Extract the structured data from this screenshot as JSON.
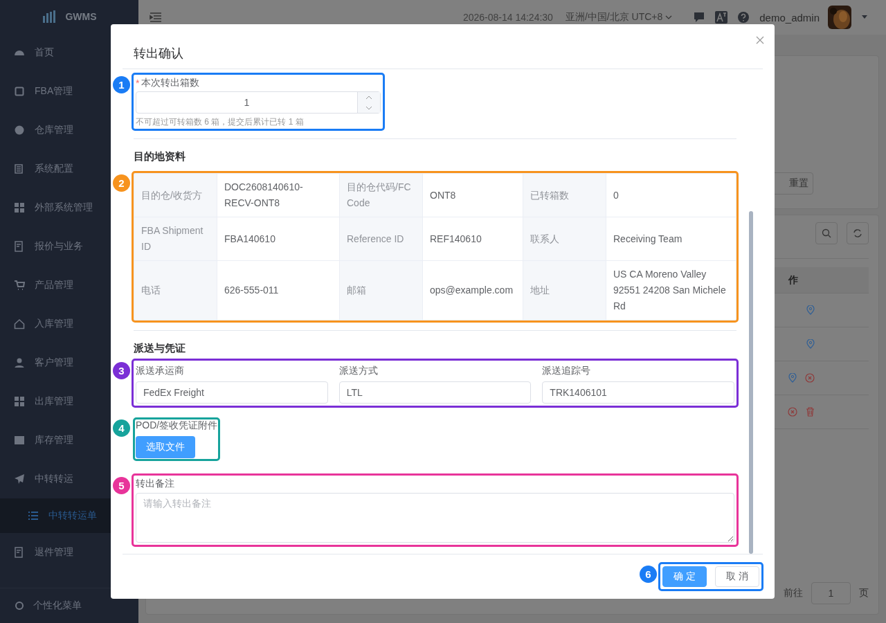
{
  "sidebar": {
    "logo": "GWMS",
    "items": [
      {
        "label": "首页",
        "selected": false
      },
      {
        "label": "FBA管理",
        "selected": false
      },
      {
        "label": "仓库管理",
        "selected": false
      },
      {
        "label": "系统配置",
        "selected": false
      },
      {
        "label": "外部系统管理",
        "selected": false
      },
      {
        "label": "报价与业务",
        "selected": false
      },
      {
        "label": "产品管理",
        "selected": false
      },
      {
        "label": "入库管理",
        "selected": false
      },
      {
        "label": "客户管理",
        "selected": false
      },
      {
        "label": "出库管理",
        "selected": false
      },
      {
        "label": "库存管理",
        "selected": false
      },
      {
        "label": "中转转运",
        "selected": false,
        "expanded": true,
        "children": [
          {
            "label": "中转转运单",
            "selected": true
          }
        ]
      },
      {
        "label": "退件管理",
        "selected": false
      }
    ],
    "footer": "个性化菜单"
  },
  "topbar": {
    "datetime": "2026-08-14 14:24:30",
    "timezone": "亚洲/中国/北京 UTC+8",
    "user": "demo_admin"
  },
  "background": {
    "reset_button": "重置",
    "column_header": "作",
    "pager": {
      "goto_label": "前往",
      "page": "1",
      "page_unit": "页"
    }
  },
  "dialog": {
    "title": "转出确认",
    "quantity": {
      "label": "本次转出箱数",
      "required_mark": "*",
      "value": "1",
      "hint": "不可超过可转箱数 6 箱，提交后累计已转 1 箱",
      "callout": {
        "number": "1",
        "color": "#1a7cf5"
      }
    },
    "destination": {
      "title": "目的地资料",
      "callout": {
        "number": "2",
        "color": "#f7931e"
      },
      "rows": [
        [
          {
            "label": "目的仓/收货方",
            "value": "DOC2608140610-RECV-ONT8"
          },
          {
            "label": "目的仓代码/FC Code",
            "value": "ONT8"
          },
          {
            "label": "已转箱数",
            "value": "0"
          }
        ],
        [
          {
            "label": "FBA Shipment ID",
            "value": "FBA140610"
          },
          {
            "label": "Reference ID",
            "value": "REF140610"
          },
          {
            "label": "联系人",
            "value": "Receiving Team"
          }
        ],
        [
          {
            "label": "电话",
            "value": "626-555-011"
          },
          {
            "label": "邮箱",
            "value": "ops@example.com"
          },
          {
            "label": "地址",
            "value": "US CA Moreno Valley 92551 24208 San Michele Rd"
          }
        ]
      ]
    },
    "delivery": {
      "title": "派送与凭证",
      "callout": {
        "number": "3",
        "color": "#7b2fd6"
      },
      "fields": [
        {
          "label": "派送承运商",
          "value": "FedEx Freight"
        },
        {
          "label": "派送方式",
          "value": "LTL"
        },
        {
          "label": "派送追踪号",
          "value": "TRK1406101"
        }
      ]
    },
    "attachment": {
      "label": "POD/签收凭证附件",
      "button": "选取文件",
      "callout": {
        "number": "4",
        "color": "#17a39c"
      }
    },
    "remark": {
      "label": "转出备注",
      "placeholder": "请输入转出备注",
      "callout": {
        "number": "5",
        "color": "#e8349a"
      }
    },
    "buttons": [
      {
        "label": "确 定",
        "primary": true
      },
      {
        "label": "取 消",
        "primary": false
      }
    ],
    "buttons_callout": {
      "number": "6",
      "color": "#1a7cf5"
    }
  }
}
